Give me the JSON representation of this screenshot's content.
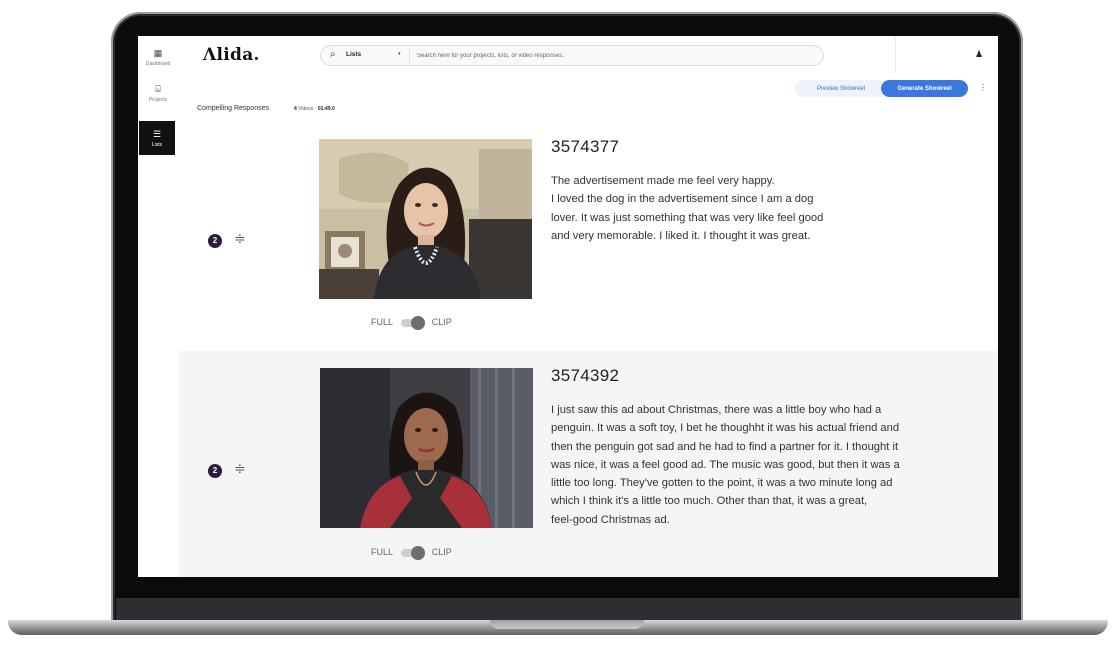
{
  "sidebar": {
    "items": [
      {
        "label": "Dashboard",
        "icon": "dashboard-icon"
      },
      {
        "label": "Projects",
        "icon": "projects-icon"
      },
      {
        "label": "Lists",
        "icon": "lists-icon",
        "active": true
      }
    ]
  },
  "header": {
    "logo": "Λlida.",
    "search": {
      "scope": "Lists",
      "placeholder": "Search here for your projects, lists, or video responses."
    }
  },
  "list": {
    "title": "Compelling Responses",
    "video_count": "4",
    "videos_label": "Videos ·",
    "duration": "01:49.0",
    "preview_label": "Preview Showreel",
    "generate_label": "Generate Showreel"
  },
  "responses": [
    {
      "id": "3574377",
      "badge": "2",
      "toggle_left": "FULL",
      "toggle_right": "CLIP",
      "text_lines": [
        "The advertisement made me feel very happy.",
        "I loved the dog in the advertisement since I am a dog",
        "lover. It was just something that was very like feel good",
        "and very memorable. I liked it. I thought it was great."
      ]
    },
    {
      "id": "3574392",
      "badge": "2",
      "toggle_left": "FULL",
      "toggle_right": "CLIP",
      "text_lines": [
        "I just saw this ad about Christmas, there was a little boy who had a",
        "penguin. It was a soft toy, I bet he thoughht it was his actual friend and",
        "then the penguin got sad and he had to find a partner for it. I thought it",
        "was nice, it was a feel good ad. The music was good, but then it was a",
        "little too long. They've gotten to the point, it was a two minute long ad",
        "which I think it's a little too much. Other than that, it was a great,",
        "feel-good Christmas ad."
      ]
    }
  ],
  "colors": {
    "accent": "#3b78de",
    "badge": "#2c1d3e",
    "sidebar_active": "#111111"
  }
}
